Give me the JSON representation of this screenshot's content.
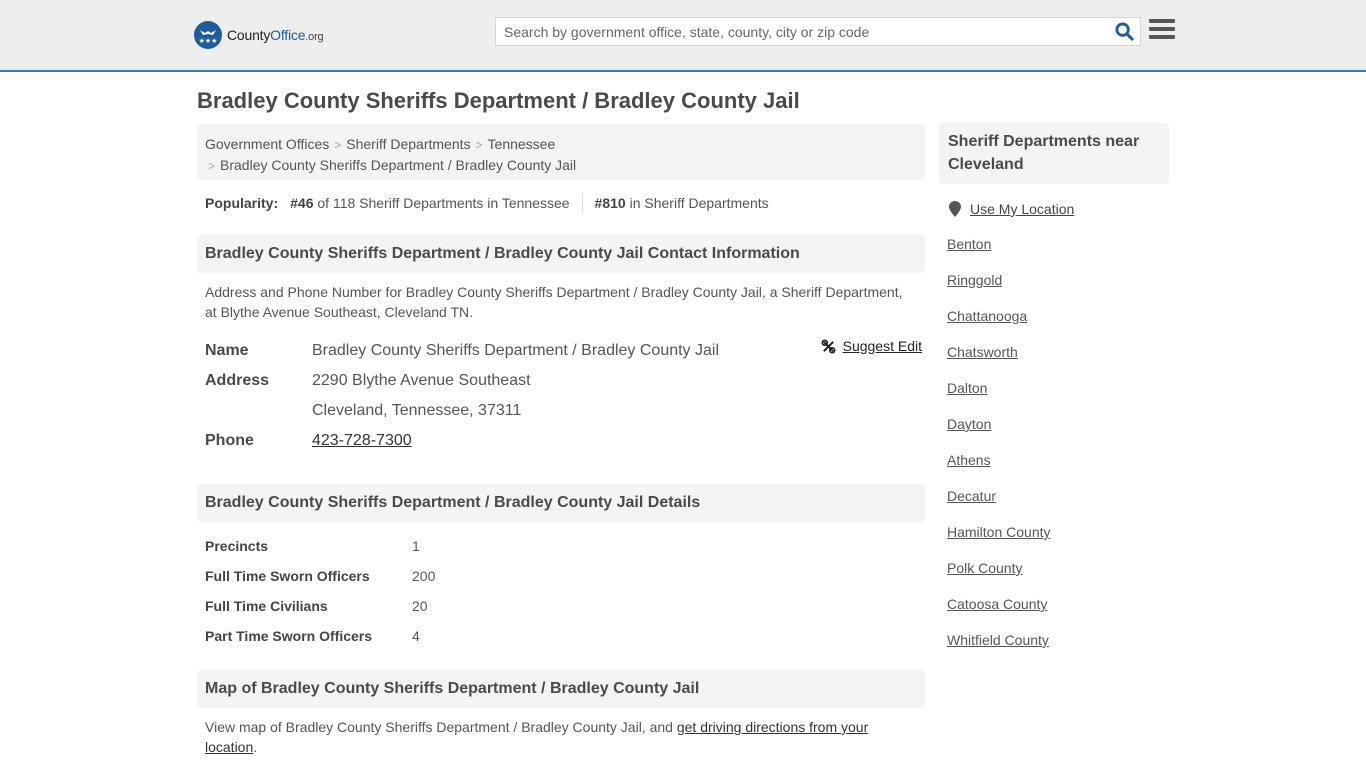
{
  "header": {
    "logo": {
      "county": "County",
      "office": "Office",
      "org": ".org"
    },
    "search": {
      "placeholder": "Search by government office, state, county, city or zip code",
      "value": ""
    },
    "colors": {
      "accent": "#1f5c9e",
      "border": "#3a7aad"
    }
  },
  "page_title": "Bradley County Sheriffs Department / Bradley County Jail",
  "breadcrumb": [
    {
      "label": "Government Offices"
    },
    {
      "label": "Sheriff Departments"
    },
    {
      "label": "Tennessee"
    },
    {
      "label": "Bradley County Sheriffs Department / Bradley County Jail"
    }
  ],
  "popularity": {
    "label": "Popularity:",
    "state_rank": "#46",
    "state_rank_text": "of 118 Sheriff Departments in Tennessee",
    "national_rank": "#810",
    "national_rank_text": "in Sheriff Departments"
  },
  "contact": {
    "heading": "Bradley County Sheriffs Department / Bradley County Jail Contact Information",
    "description": "Address and Phone Number for Bradley County Sheriffs Department / Bradley County Jail, a Sheriff Department, at Blythe Avenue Southeast, Cleveland TN.",
    "suggest_edit": "Suggest Edit",
    "name_label": "Name",
    "name_value": "Bradley County Sheriffs Department / Bradley County Jail",
    "address_label": "Address",
    "address_line1": "2290 Blythe Avenue Southeast",
    "address_line2": "Cleveland, Tennessee, 37311",
    "phone_label": "Phone",
    "phone_value": "423-728-7300"
  },
  "details": {
    "heading": "Bradley County Sheriffs Department / Bradley County Jail Details",
    "rows": [
      {
        "label": "Precincts",
        "value": "1"
      },
      {
        "label": "Full Time Sworn Officers",
        "value": "200"
      },
      {
        "label": "Full Time Civilians",
        "value": "20"
      },
      {
        "label": "Part Time Sworn Officers",
        "value": "4"
      }
    ]
  },
  "map": {
    "heading": "Map of Bradley County Sheriffs Department / Bradley County Jail",
    "text": "View map of Bradley County Sheriffs Department / Bradley County Jail, and ",
    "link": "get driving directions from your location",
    "suffix": "."
  },
  "sidebar": {
    "heading": "Sheriff Departments near Cleveland",
    "use_location": "Use My Location",
    "items": [
      {
        "label": "Benton"
      },
      {
        "label": "Ringgold"
      },
      {
        "label": "Chattanooga"
      },
      {
        "label": "Chatsworth"
      },
      {
        "label": "Dalton"
      },
      {
        "label": "Dayton"
      },
      {
        "label": "Athens"
      },
      {
        "label": "Decatur"
      },
      {
        "label": "Hamilton County"
      },
      {
        "label": "Polk County"
      },
      {
        "label": "Catoosa County"
      },
      {
        "label": "Whitfield County"
      }
    ]
  }
}
